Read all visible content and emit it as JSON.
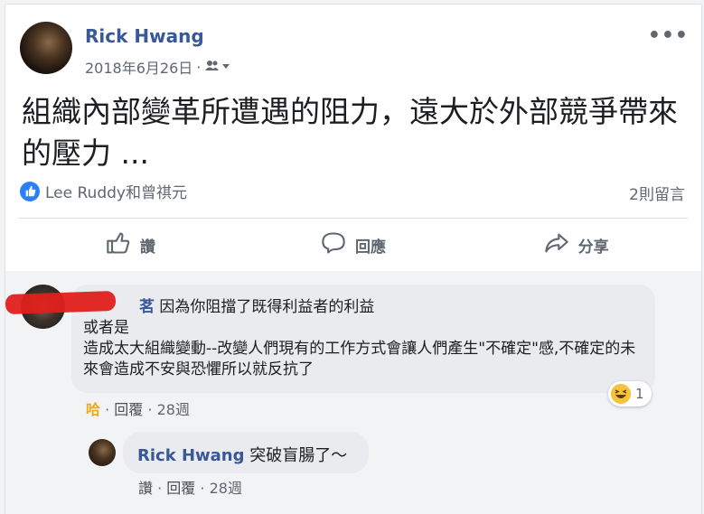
{
  "post": {
    "author": "Rick Hwang",
    "date": "2018年6月26日",
    "meta_sep": "·",
    "text": "組織內部變革所遭遇的阻力，遠大於外部競爭帶來的壓力 ...",
    "reactors": "Lee Ruddy和曾祺元",
    "comment_count": "2則留言",
    "actions": {
      "like": "讚",
      "comment": "回應",
      "share": "分享"
    }
  },
  "comments": [
    {
      "name_fragment": "茗",
      "text_line1": "因為你阻擋了既得利益者的利益",
      "text_line2": "或者是",
      "text_line3": "造成太大組織變動--改變人們現有的工作方式會讓人們產生\"不確定\"感,不確定的未來會造成不安與恐懼所以就反抗了",
      "reaction_count": "1",
      "reaction_label": "哈",
      "reply_label": "回覆",
      "time": "28週",
      "sep": "·"
    }
  ],
  "reply": {
    "author": "Rick Hwang",
    "text": "突破盲腸了～",
    "like_label": "讚",
    "reply_label": "回覆",
    "time": "28週",
    "sep": "·"
  },
  "icons": {
    "like": "thumbs-up-icon",
    "comment": "speech-bubble-icon",
    "share": "share-arrow-icon",
    "audience": "friends-icon",
    "more": "more-icon",
    "reaction": "haha-emoji-icon"
  },
  "colors": {
    "link_blue": "#385898",
    "like_blue": "#2d7ff9",
    "muted": "#616770",
    "haha_orange": "#f0a818",
    "bubble_bg": "#e9ebee"
  }
}
